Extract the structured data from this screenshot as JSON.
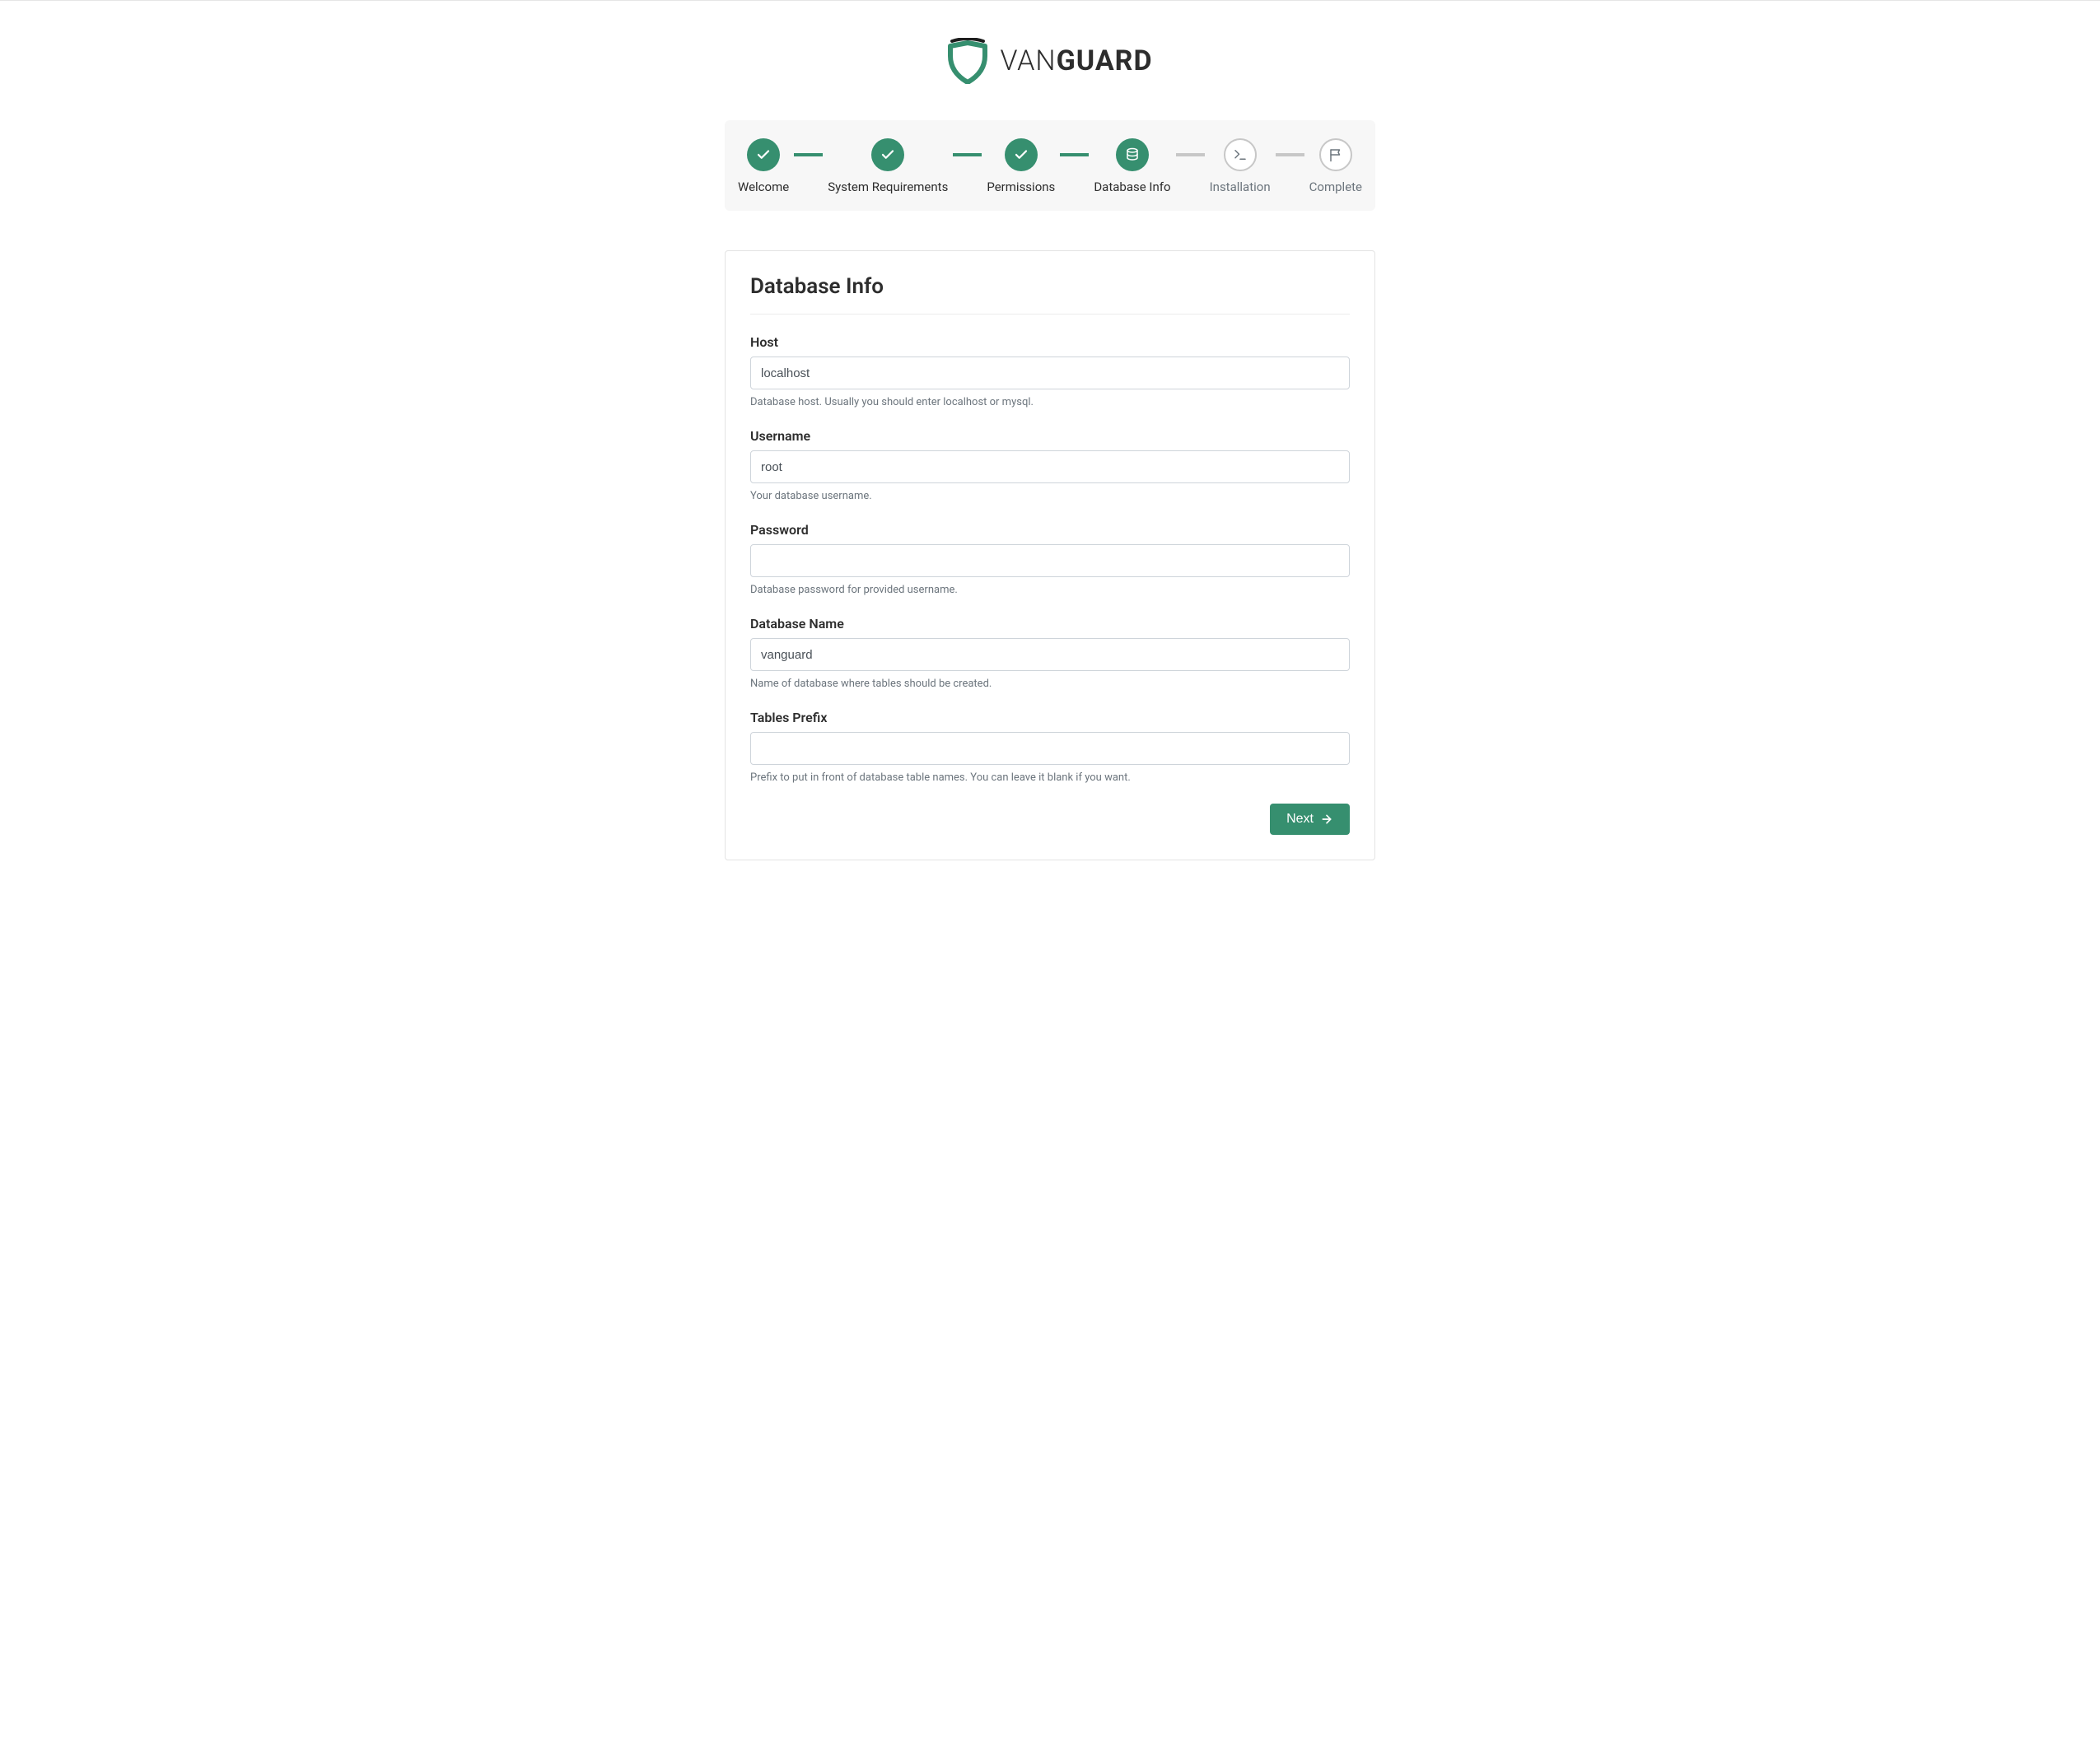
{
  "brand": {
    "part1": "VAN",
    "part2": "GUARD"
  },
  "wizard": {
    "steps": [
      {
        "label": "Welcome",
        "state": "done",
        "icon": "check"
      },
      {
        "label": "System Requirements",
        "state": "done",
        "icon": "check"
      },
      {
        "label": "Permissions",
        "state": "done",
        "icon": "check"
      },
      {
        "label": "Database Info",
        "state": "active",
        "icon": "database"
      },
      {
        "label": "Installation",
        "state": "pending",
        "icon": "terminal"
      },
      {
        "label": "Complete",
        "state": "pending",
        "icon": "flag"
      }
    ]
  },
  "card": {
    "title": "Database Info",
    "fields": {
      "host": {
        "label": "Host",
        "value": "localhost",
        "placeholder": "",
        "help": "Database host. Usually you should enter localhost or mysql.",
        "type": "text"
      },
      "username": {
        "label": "Username",
        "value": "root",
        "placeholder": "",
        "help": "Your database username.",
        "type": "text"
      },
      "password": {
        "label": "Password",
        "value": "",
        "placeholder": "",
        "help": "Database password for provided username.",
        "type": "password"
      },
      "dbname": {
        "label": "Database Name",
        "value": "vanguard",
        "placeholder": "",
        "help": "Name of database where tables should be created.",
        "type": "text"
      },
      "prefix": {
        "label": "Tables Prefix",
        "value": "",
        "placeholder": "",
        "help": "Prefix to put in front of database table names. You can leave it blank if you want.",
        "type": "text"
      }
    },
    "next_label": "Next"
  },
  "colors": {
    "accent": "#368f6f",
    "muted": "#6c757d",
    "border": "#ced4da"
  }
}
